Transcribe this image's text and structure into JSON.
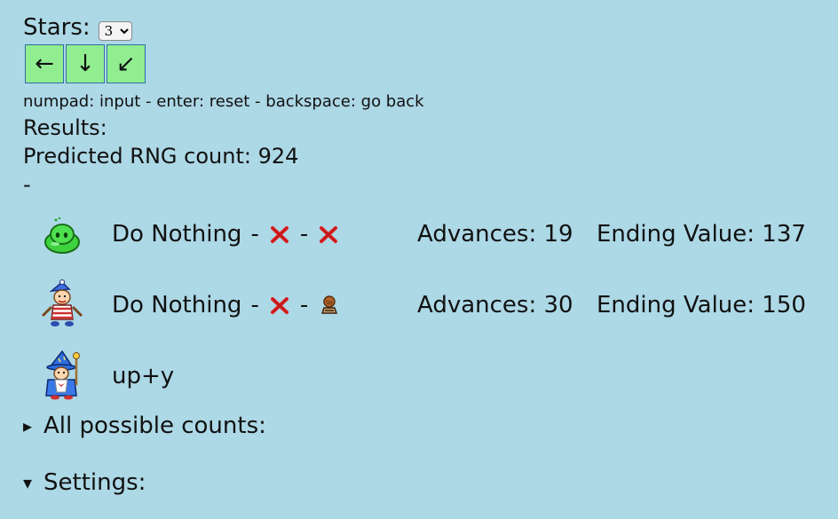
{
  "controls": {
    "stars_label": "Stars:",
    "stars_value": "3",
    "arrows": [
      {
        "label": "←",
        "icon": "arrow-left-icon"
      },
      {
        "label": "↓",
        "icon": "arrow-down-icon"
      },
      {
        "label": "↙",
        "icon": "arrow-down-left-icon"
      }
    ],
    "help_text": "numpad: input - enter: reset - backspace: go back"
  },
  "results": {
    "title": "Results:",
    "predicted_label": "Predicted RNG count: 924",
    "separator": "-",
    "rows": [
      {
        "icon": "green-slime-icon",
        "action": "Do Nothing",
        "dash": "-",
        "first_icon": "red-x-icon",
        "second_icon": "red-x-icon",
        "advances": "Advances: 19",
        "ending": "Ending Value: 137"
      },
      {
        "icon": "clown-character-icon",
        "action": "Do Nothing",
        "dash": "-",
        "first_icon": "red-x-icon",
        "second_icon": "brown-item-icon",
        "advances": "Advances: 30",
        "ending": "Ending Value: 150"
      },
      {
        "icon": "blue-wizard-icon",
        "action": "up+y"
      }
    ]
  },
  "sections": {
    "all_counts": {
      "marker": "▸",
      "label": "All possible counts:"
    },
    "settings": {
      "marker": "▾",
      "label": "Settings:"
    }
  },
  "colors": {
    "background": "#add8e6",
    "button": "#90ee90",
    "x_mark": "#e02020"
  }
}
